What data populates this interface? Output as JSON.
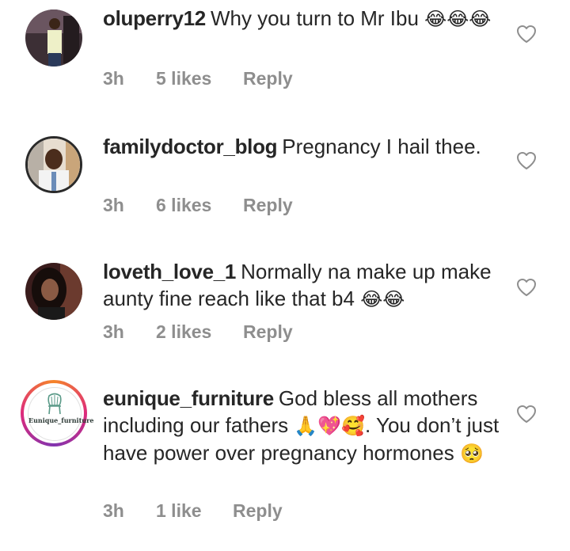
{
  "comments": [
    {
      "username": "oluperry12",
      "text": "Why you turn to Mr Ibu",
      "emoji": "😂😂😂",
      "time": "3h",
      "likes": "5 likes",
      "reply": "Reply"
    },
    {
      "username": "familydoctor_blog",
      "text": "Pregnancy I hail thee.",
      "emoji": "",
      "time": "3h",
      "likes": "6 likes",
      "reply": "Reply"
    },
    {
      "username": "loveth_love_1",
      "text": "Normally na make up make aunty fine reach like that b4",
      "emoji": "😂😂",
      "time": "3h",
      "likes": "2 likes",
      "reply": "Reply"
    },
    {
      "username": "eunique_furniture",
      "text": "God bless all mothers including our fathers",
      "emoji": "🙏💖🥰",
      "text2": ". You don’t just have power over pregnancy hormones",
      "emoji2": "🥺",
      "time": "3h",
      "likes": "1 like",
      "reply": "Reply",
      "logo_text": "Eunique_furniture"
    }
  ],
  "icons": {
    "like": "heart-outline-icon"
  },
  "colors": {
    "text": "#262626",
    "meta": "#8e8e8e",
    "heart": "#8e8e8e"
  }
}
